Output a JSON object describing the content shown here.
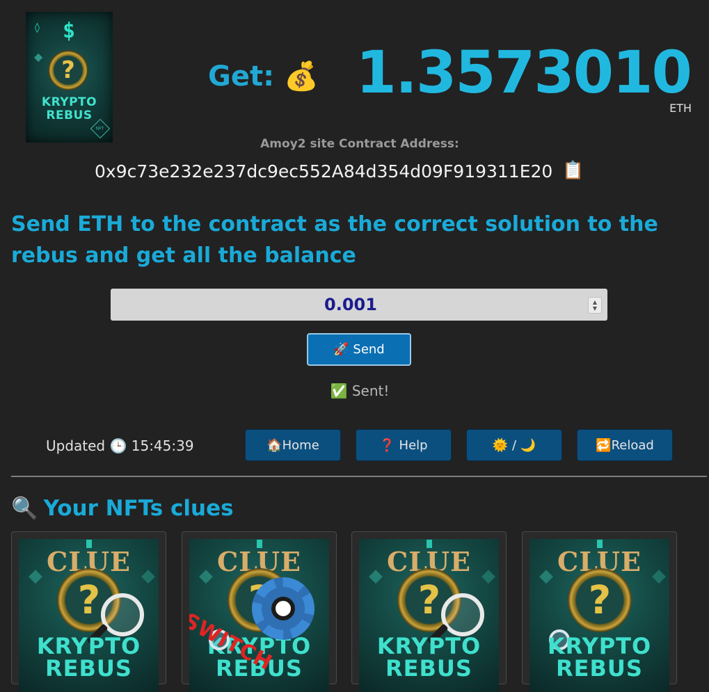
{
  "logo": {
    "line1": "KRYPTO",
    "line2": "REBUS",
    "symbol": "$",
    "coin_glyph": "?",
    "badge": "NFT"
  },
  "prize": {
    "label": "Get:",
    "icon": "💰",
    "value": "1.3573010",
    "unit": "ETH"
  },
  "contract": {
    "label": "Amoy2 site Contract Address:",
    "address": "0x9c73e232e237dc9ec552A84d354d09F919311E20",
    "copy_icon": "📋"
  },
  "instructions": "Send ETH to the contract as the correct solution to the rebus and get all the balance",
  "form": {
    "amount_value": "0.001",
    "send_label": "🚀 Send",
    "status": "✅ Sent!"
  },
  "toolbar": {
    "updated": "Updated 🕒 15:45:39",
    "home_label": "🏠Home",
    "help_label": "❓ Help",
    "theme_label": "🌞 / 🌙",
    "reload_label": "🔁Reload"
  },
  "nfts": {
    "title_icon": "🔍",
    "title": "Your NFTs clues",
    "cards": [
      {
        "heading": "CLUE",
        "glyph": "?",
        "name": "KRYPTO\nREBUS",
        "overlay": "magnifier"
      },
      {
        "heading": "CLUE",
        "glyph": "?",
        "name": "KRYPTO\nREBUS",
        "overlay": "switch-gear",
        "overlay_text": "SWITCH"
      },
      {
        "heading": "CLUE",
        "glyph": "?",
        "name": "KRYPTO\nREBUS",
        "overlay": "magnifier"
      },
      {
        "heading": "CLUE",
        "glyph": "?",
        "name": "KRYPTO\nREBUS",
        "overlay": "small-magnifier"
      }
    ]
  }
}
